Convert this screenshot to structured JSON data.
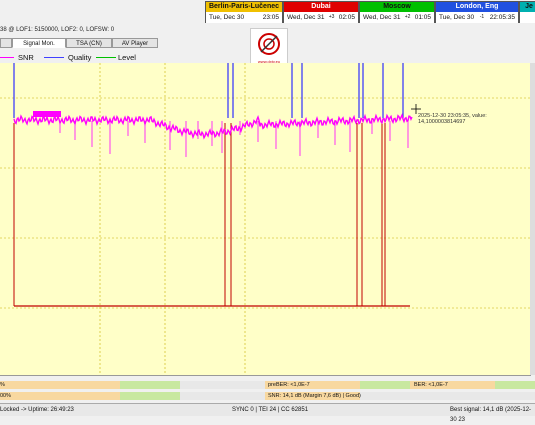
{
  "clocks": [
    {
      "name": "Berlin-Paris-Lučenec",
      "day": "Tue, Dec 30",
      "time": "23:05",
      "color": "#f0c000",
      "text": "#000"
    },
    {
      "name": "Dubai",
      "day": "Wed, Dec 31",
      "offset": "+3",
      "time": "02:05",
      "color": "#e00000",
      "text": "#fff"
    },
    {
      "name": "Moscow",
      "day": "Wed, Dec 31",
      "offset": "+2",
      "time": "01:05",
      "color": "#00c000",
      "text": "#000"
    },
    {
      "name": "London, Eng",
      "day": "Tue, Dec 30",
      "offset": "-1",
      "time": "22:05:35",
      "color": "#2050e0",
      "text": "#fff"
    },
    {
      "name": "Je",
      "day": "",
      "time": "",
      "color": "#00b0b0",
      "text": "#000"
    }
  ],
  "tuner_info": "38 @ LOF1: 5150000, LOF2: 0, LOFSW: 0",
  "tabs": [
    "",
    "Signal Mon.",
    "TSA (CN)",
    "AV Player"
  ],
  "logo_text": "www.dxtv.eu",
  "legend": [
    {
      "label": "SNR",
      "color": "#ff00ff"
    },
    {
      "label": "Quality",
      "color": "#4040ff"
    },
    {
      "label": "Level",
      "color": "#00c000"
    }
  ],
  "cursor_annotation": "2025-12-30 23:05:35, value: 14,1000003814697",
  "bars": {
    "row1": {
      "left": "%",
      "prebert": "preBER: <1,0E-7",
      "ber": "BER: <1,0E-7"
    },
    "row2": {
      "left": "00%",
      "snr": "SNR: 14,1 dB (Margin 7,6 dB) | Good)"
    }
  },
  "status": {
    "locked": "Locked -> Uptime: 26:49:23",
    "sync": "SYNC 0 | TEI 24 | CC 62851",
    "best": "Best signal: 14,1 dB (2025-12-30 23"
  }
}
